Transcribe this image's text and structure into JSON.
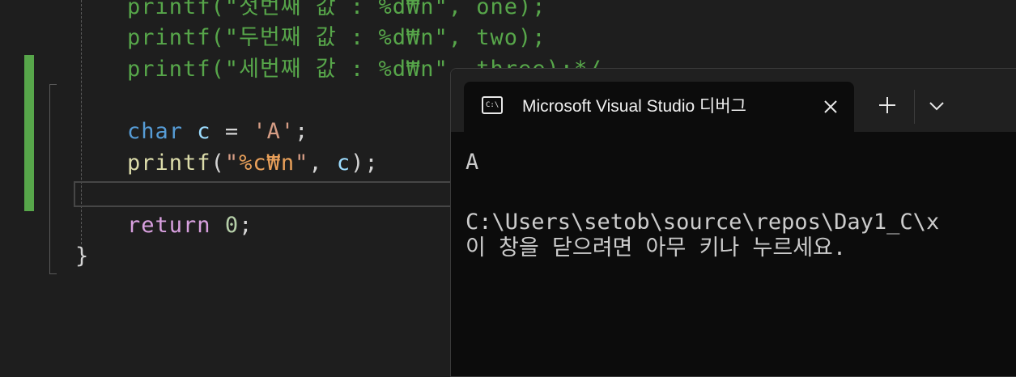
{
  "editor": {
    "lines": {
      "l1": {
        "fn": "printf",
        "open": "(\"",
        "text": "첫번째 값 : %d₩n\", one);"
      },
      "l2": {
        "fn": "printf",
        "open": "(\"",
        "text": "두번째 값 : %d₩n\", two);"
      },
      "l3": {
        "fn": "printf",
        "open": "(\"",
        "text": "세번째 값 : %d₩n\", three);*/"
      },
      "l4": {
        "kw": "char",
        "var": "c",
        "op": " = ",
        "str": "'A'",
        "end": ";"
      },
      "l5": {
        "fn": "printf",
        "open": "(",
        "q1": "\"",
        "fmt": "%c₩n",
        "q2": "\"",
        "sep": ", ",
        "var": "c",
        "end": ");"
      },
      "l7": {
        "kw": "return",
        "num": "0",
        "end": ";"
      },
      "l8": {
        "brace": "}"
      }
    }
  },
  "console": {
    "tab_title": "Microsoft Visual Studio 디버그",
    "icon_label": "C:\\",
    "output": {
      "line1": "A",
      "line2": "C:\\Users\\setob\\source\\repos\\Day1_C\\x",
      "line3": "이 창을 닫으려면 아무 키나 누르세요."
    }
  },
  "icons": {
    "terminal": "terminal-icon",
    "close": "close-icon",
    "new_tab": "plus-icon",
    "dropdown": "chevron-down-icon"
  },
  "colors": {
    "editor_bg": "#1e1e1e",
    "change_bar": "#57a64a",
    "comment": "#57a64a",
    "keyword": "#569cd6",
    "console_bg": "#0c0c0c"
  }
}
